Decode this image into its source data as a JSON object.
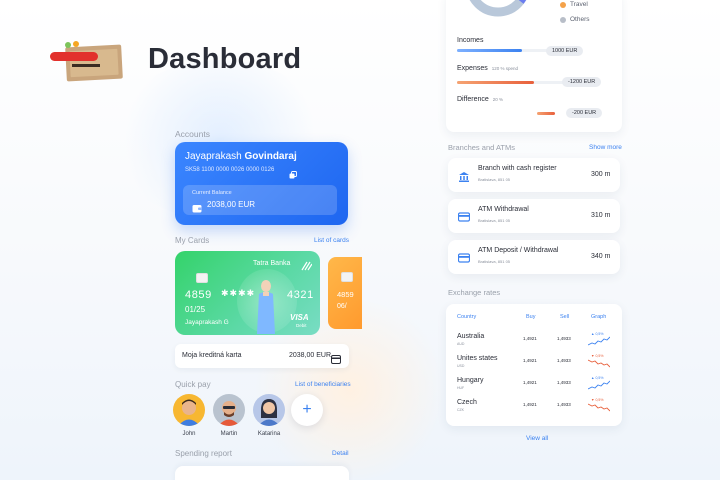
{
  "header": {
    "title": "Dashboard"
  },
  "colors": {
    "accent": "#3c82f0",
    "income": "#3c82f0",
    "expense": "#e8603c",
    "green_card": "#34d36a",
    "orange_card": "#ffb84a"
  },
  "legend": [
    {
      "label": "Travel",
      "color": "#f4a24a"
    },
    {
      "label": "Others",
      "color": "#b8bec8"
    }
  ],
  "summary": {
    "incomes": {
      "label": "Incomes",
      "value": "1000 EUR",
      "level": 0.55
    },
    "expenses": {
      "label": "Expenses",
      "sub": "120 % spend",
      "value": "-1200 EUR",
      "level": 0.65
    },
    "difference": {
      "label": "Difference",
      "sub": "20 %",
      "value": "-200 EUR",
      "level": 0.15
    }
  },
  "accounts": {
    "label": "Accounts",
    "holder_first": "Jayaprakash",
    "holder_last": "Govindaraj",
    "iban": "SK58 1100 0000 0026 0000 0126",
    "balance_label": "Current Balance",
    "balance_value": "2038,00 EUR"
  },
  "cards": {
    "label": "My Cards",
    "link": "List of cards",
    "green": {
      "bank": "Tatra Banka",
      "num_left": "4859",
      "num_right": "4321",
      "expiry": "01/25",
      "holder": "Jayaprakash G",
      "brand": "VISA",
      "brand_sub": "Debit"
    },
    "orange": {
      "num": "4859",
      "expiry": "06/"
    },
    "limit_label": "Moja kreditná karta",
    "limit_value": "2038,00 EUR"
  },
  "quickpay": {
    "label": "Quick pay",
    "link": "List of beneficiaries",
    "people": [
      {
        "name": "John"
      },
      {
        "name": "Martin"
      },
      {
        "name": "Katarina"
      }
    ],
    "add": "+"
  },
  "spending": {
    "label": "Spending report",
    "link": "Detail"
  },
  "branches": {
    "label": "Branches and ATMs",
    "link": "Show more",
    "items": [
      {
        "title": "Branch with cash register",
        "addr": "Bratislava, 851 05",
        "dist": "300 m",
        "icon": "bank-icon"
      },
      {
        "title": "ATM Withdrawal",
        "addr": "Bratislava, 851 05",
        "dist": "310 m",
        "icon": "atm-icon"
      },
      {
        "title": "ATM Deposit / Withdrawal",
        "addr": "Bratislava, 851 05",
        "dist": "340 m",
        "icon": "atm-icon"
      }
    ]
  },
  "rates": {
    "label": "Exchange rates",
    "headers": [
      "Country",
      "Buy",
      "Sell",
      "Graph"
    ],
    "rows": [
      {
        "country": "Australia",
        "code": "AUD",
        "buy": "1,4921",
        "sell": "1,4933",
        "trend": "up",
        "pct": "0,5%"
      },
      {
        "country": "Unites states",
        "code": "USD",
        "buy": "1,4921",
        "sell": "1,4933",
        "trend": "down",
        "pct": "0,5%"
      },
      {
        "country": "Hungary",
        "code": "HUF",
        "buy": "1,4921",
        "sell": "1,4933",
        "trend": "up",
        "pct": "0,5%"
      },
      {
        "country": "Czech",
        "code": "CZK",
        "buy": "1,4921",
        "sell": "1,4933",
        "trend": "down",
        "pct": "0,5%"
      }
    ],
    "view_all": "View all"
  }
}
